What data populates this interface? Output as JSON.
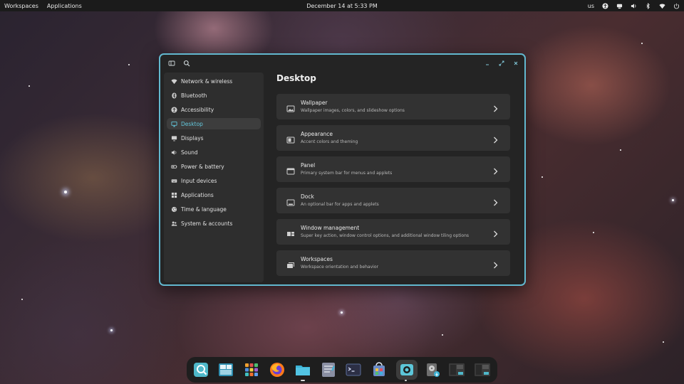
{
  "topbar": {
    "workspaces": "Workspaces",
    "applications": "Applications",
    "clock": "December 14 at 5:33 PM",
    "keyboard_layout": "us",
    "tray_icons": [
      "accessibility-icon",
      "network-share-icon",
      "volume-icon",
      "bluetooth-icon",
      "wifi-icon",
      "power-icon"
    ]
  },
  "window": {
    "accent_color": "#62b8cf",
    "titlebar_icons": [
      "sidebar-toggle-icon",
      "search-icon",
      "minimize-icon",
      "maximize-icon",
      "close-icon"
    ]
  },
  "sidebar": {
    "items": [
      {
        "label": "Network & wireless",
        "icon": "wifi-icon"
      },
      {
        "label": "Bluetooth",
        "icon": "bluetooth-icon"
      },
      {
        "label": "Accessibility",
        "icon": "accessibility-icon"
      },
      {
        "label": "Desktop",
        "icon": "desktop-icon",
        "active": true
      },
      {
        "label": "Displays",
        "icon": "display-icon"
      },
      {
        "label": "Sound",
        "icon": "speaker-icon"
      },
      {
        "label": "Power & battery",
        "icon": "battery-icon"
      },
      {
        "label": "Input devices",
        "icon": "keyboard-icon"
      },
      {
        "label": "Applications",
        "icon": "apps-grid-icon"
      },
      {
        "label": "Time & language",
        "icon": "globe-icon"
      },
      {
        "label": "System & accounts",
        "icon": "users-icon"
      }
    ]
  },
  "content": {
    "title": "Desktop",
    "cards": [
      {
        "title": "Wallpaper",
        "description": "Wallpaper images, colors, and slideshow options",
        "icon": "wallpaper-icon"
      },
      {
        "title": "Appearance",
        "description": "Accent colors and theming",
        "icon": "appearance-icon"
      },
      {
        "title": "Panel",
        "description": "Primary system bar for menus and applets",
        "icon": "panel-icon"
      },
      {
        "title": "Dock",
        "description": "An optional bar for apps and applets",
        "icon": "dock-icon"
      },
      {
        "title": "Window management",
        "description": "Super key action, window control options, and additional window tiling options",
        "icon": "window-management-icon"
      },
      {
        "title": "Workspaces",
        "description": "Workspace orientation and behavior",
        "icon": "workspaces-icon"
      }
    ]
  },
  "dock": {
    "apps": [
      {
        "icon": "launcher-search-icon",
        "color": "#4fb8c9"
      },
      {
        "icon": "workspaces-overview-icon",
        "color": "#2f8fb0"
      },
      {
        "icon": "app-library-icon",
        "color": "#f0a030"
      },
      {
        "icon": "firefox-icon",
        "color": "#ff7a1a"
      },
      {
        "icon": "files-icon",
        "color": "#3bb3d6"
      },
      {
        "icon": "text-editor-icon",
        "color": "#8a8fa3"
      },
      {
        "icon": "terminal-icon",
        "color": "#2c2f45"
      },
      {
        "icon": "store-icon",
        "color": "#6a8cc8"
      },
      {
        "icon": "settings-icon",
        "color": "#5cc6d9"
      },
      {
        "icon": "disk-installer-icon",
        "color": "#6e6e6e"
      },
      {
        "icon": "window-thumbnail-icon",
        "color": "#3a3a3a"
      },
      {
        "icon": "window-thumbnail-icon",
        "color": "#3a3a3a"
      }
    ]
  }
}
